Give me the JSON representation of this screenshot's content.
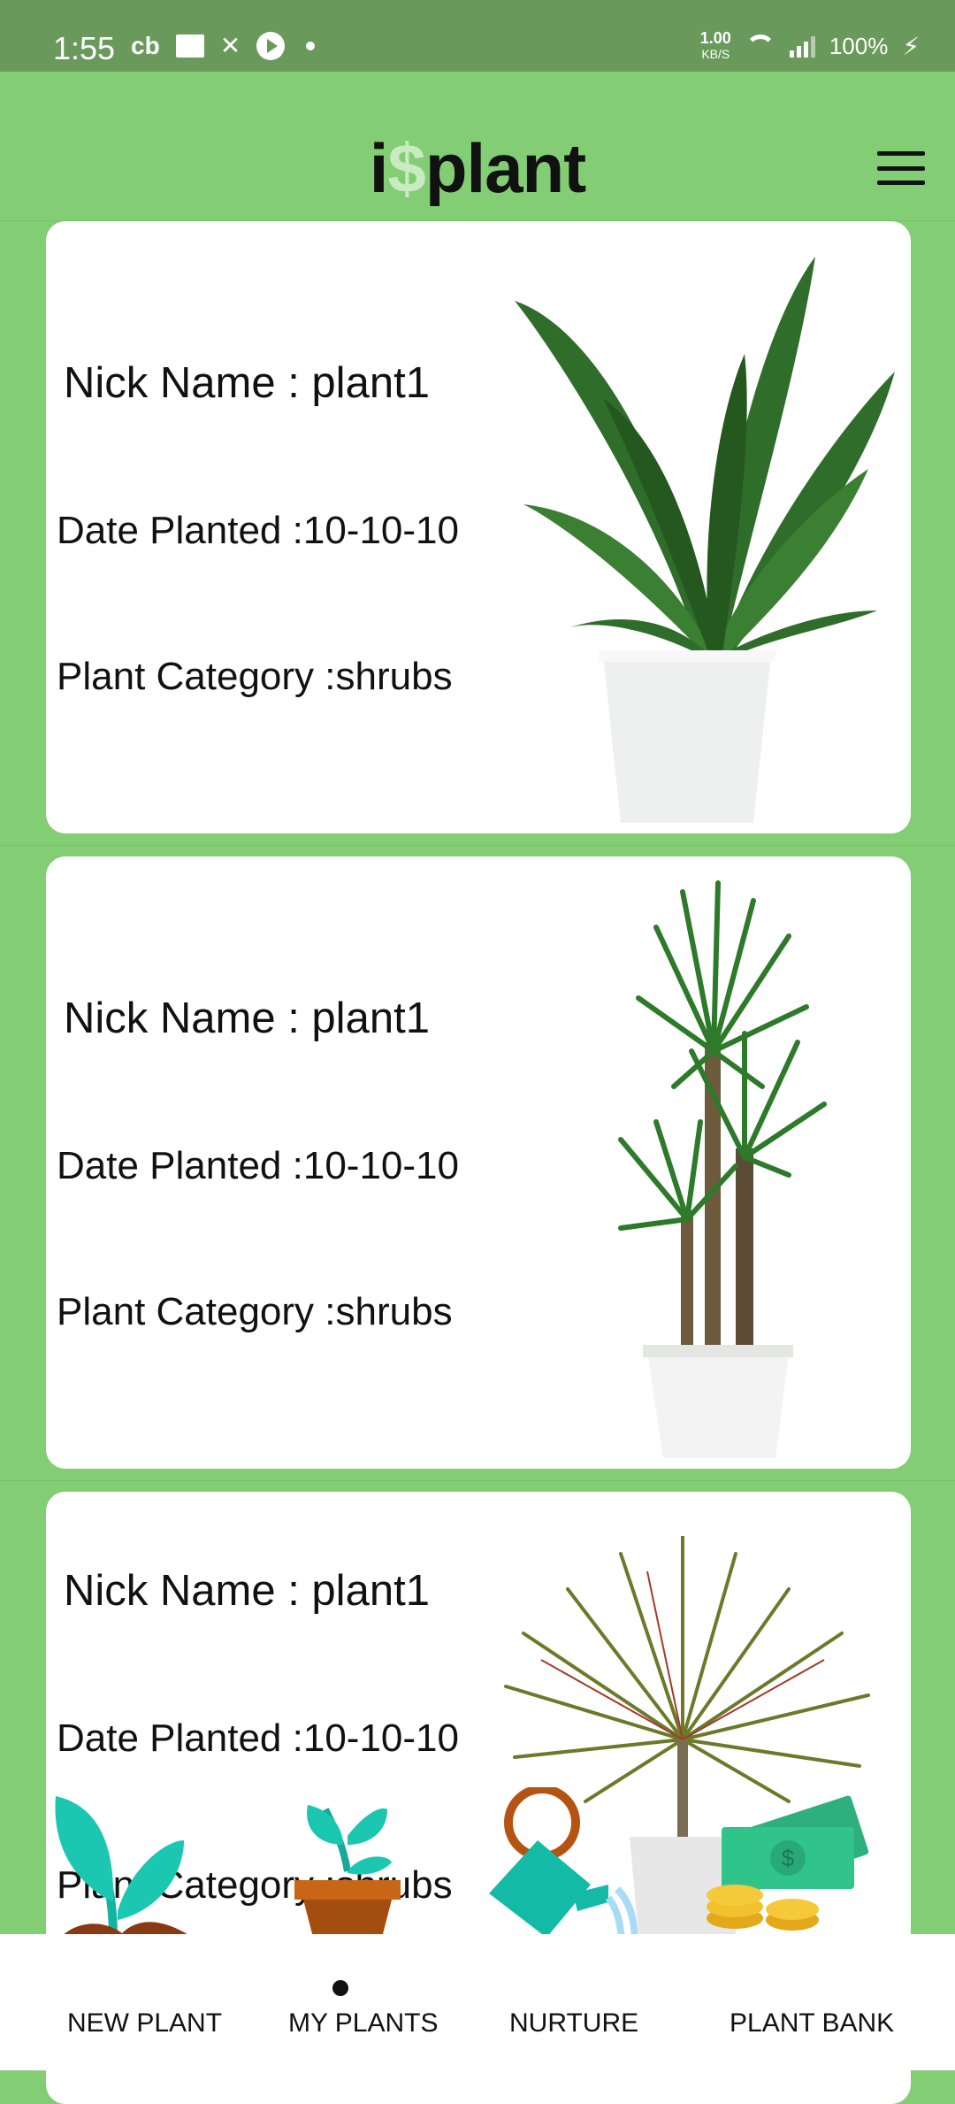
{
  "status_bar": {
    "time": "1:55",
    "left_icons": [
      "cb",
      "ad-box-icon",
      "x-icon",
      "play-icon",
      "dot-icon"
    ],
    "net_speed": "1.00",
    "net_unit": "KB/S",
    "battery": "100%"
  },
  "app_bar": {
    "title_prefix": "i",
    "title_symbol": "$",
    "title_suffix": "plant",
    "menu_icon": "hamburger-menu-icon"
  },
  "plants": [
    {
      "nick_name": "Nick Name : plant1",
      "date_planted": "Date Planted :10-10-10",
      "category": "Plant Category :shrubs",
      "image": "bird-of-paradise-plant"
    },
    {
      "nick_name": "Nick Name : plant1",
      "date_planted": "Date Planted :10-10-10",
      "category": "Plant Category :shrubs",
      "image": "yucca-plant"
    },
    {
      "nick_name": "Nick Name : plant1",
      "date_planted": "Date Planted :10-10-10",
      "category": "Plant Category :shrubs",
      "image": "dracaena-plant"
    }
  ],
  "bottom_nav": {
    "items": [
      {
        "label": "NEW PLANT",
        "icon": "sprout-icon"
      },
      {
        "label": "MY PLANTS",
        "icon": "potted-plant-icon"
      },
      {
        "label": "NURTURE",
        "icon": "watering-can-icon"
      },
      {
        "label": "PLANT BANK",
        "icon": "money-icon"
      }
    ],
    "active_index": 1
  },
  "colors": {
    "app_green": "#83cd74",
    "status_green": "#6a9a5b",
    "card_bg": "#ffffff",
    "text": "#111111"
  }
}
